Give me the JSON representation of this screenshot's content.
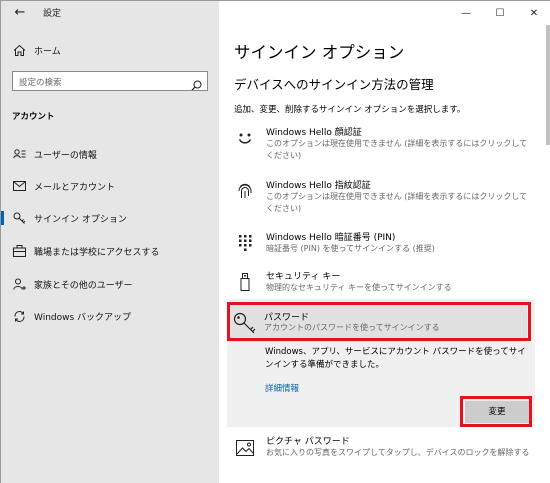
{
  "window": {
    "app_title": "設定",
    "back_icon": "←",
    "minimize": "—",
    "maximize": "☐",
    "close": "✕"
  },
  "sidebar": {
    "home_label": "ホーム",
    "search_placeholder": "設定の検索",
    "section_label": "アカウント",
    "items": [
      {
        "label": "ユーザーの情報",
        "icon": "user-info-icon"
      },
      {
        "label": "メールとアカウント",
        "icon": "mail-icon"
      },
      {
        "label": "サインイン オプション",
        "icon": "key-icon",
        "active": true
      },
      {
        "label": "職場または学校にアクセスする",
        "icon": "briefcase-icon"
      },
      {
        "label": "家族とその他のユーザー",
        "icon": "person-add-icon"
      },
      {
        "label": "Windows バックアップ",
        "icon": "sync-icon"
      }
    ]
  },
  "main": {
    "page_title": "サインイン オプション",
    "sub_title": "デバイスへのサインイン方法の管理",
    "description": "追加、変更、削除するサインイン オプションを選択します。",
    "options": [
      {
        "title": "Windows Hello 顔認証",
        "desc": "このオプションは現在使用できません (詳細を表示するにはクリックしてください)",
        "icon": "face-icon"
      },
      {
        "title": "Windows Hello 指紋認証",
        "desc": "このオプションは現在使用できません (詳細を表示するにはクリックしてください)",
        "icon": "fingerprint-icon"
      },
      {
        "title": "Windows Hello 暗証番号 (PIN)",
        "desc": "暗証番号 (PIN) を使ってサインインする (推奨)",
        "icon": "pin-keypad-icon"
      },
      {
        "title": "セキュリティ キー",
        "desc": "物理的なセキュリティ キーを使ってサインインする",
        "icon": "usb-key-icon"
      },
      {
        "title": "パスワード",
        "desc": "アカウントのパスワードを使ってサインインする",
        "icon": "password-key-icon"
      },
      {
        "title": "ピクチャ パスワード",
        "desc": "お気に入りの写真をスワイプしてタップし、デバイスのロックを解除する",
        "icon": "picture-icon"
      }
    ],
    "password_info": "Windows、アプリ、サービスにアカウント パスワードを使ってサインインする準備ができました。",
    "details_link": "詳細情報",
    "change_button": "変更"
  },
  "colors": {
    "accent": "#0063b1",
    "highlight": "#e0141e",
    "sidebar_bg": "#e6e6e6"
  }
}
